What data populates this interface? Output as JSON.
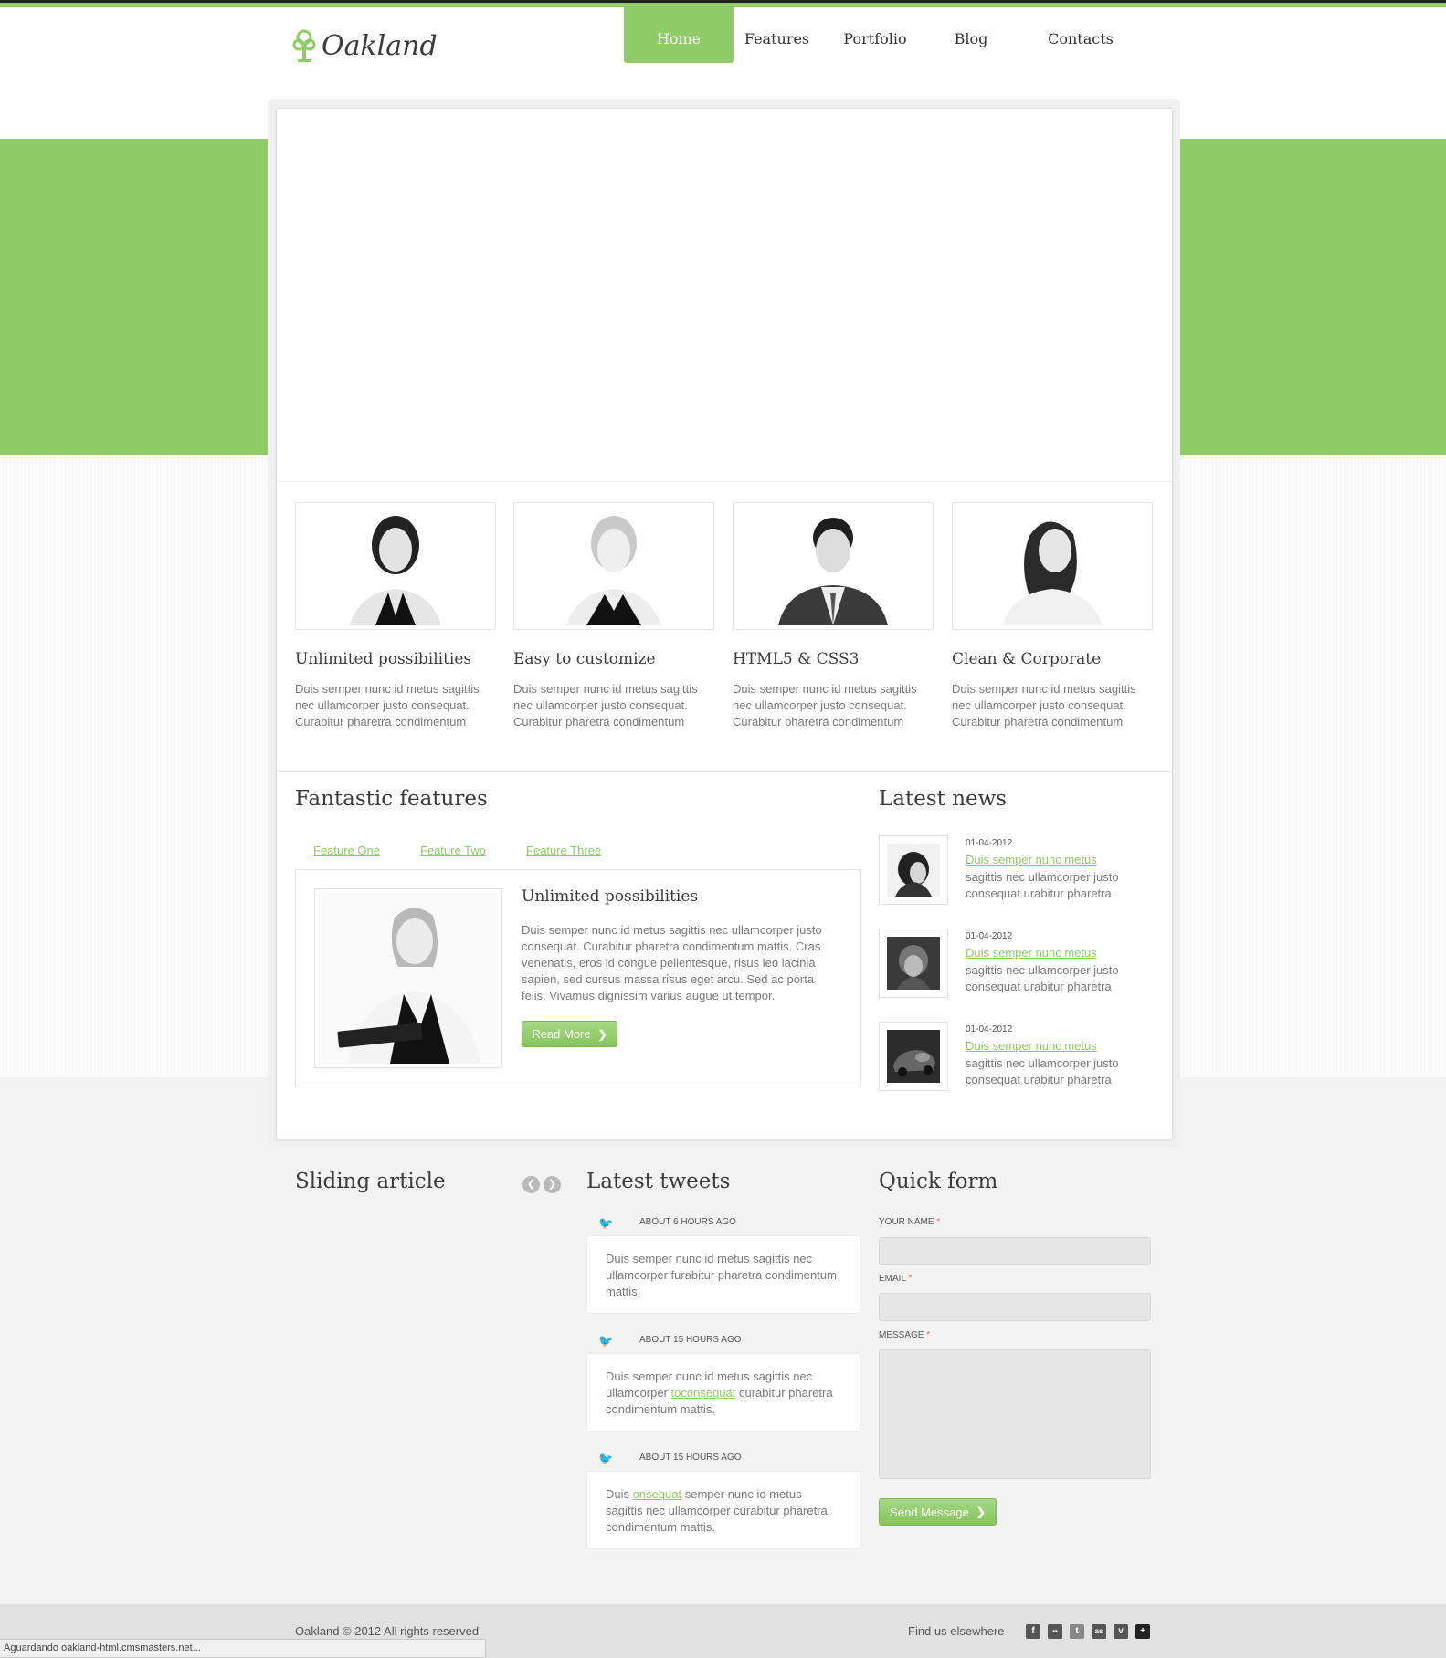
{
  "brand": {
    "name": "Oakland",
    "logo_icon": "tree-icon",
    "accent": "#8fcb67"
  },
  "nav": [
    {
      "label": "Home",
      "active": true
    },
    {
      "label": "Features",
      "active": false
    },
    {
      "label": "Portfolio",
      "active": false
    },
    {
      "label": "Blog",
      "active": false
    },
    {
      "label": "Contacts",
      "active": false
    }
  ],
  "features": [
    {
      "title": "Unlimited possibilities",
      "text": "Duis semper nunc id metus sagittis nec ullamcorper justo consequat. Curabitur pharetra condimentum"
    },
    {
      "title": "Easy to customize",
      "text": "Duis semper nunc id metus sagittis nec ullamcorper justo consequat. Curabitur pharetra condimentum"
    },
    {
      "title": "HTML5 & CSS3",
      "text": "Duis semper nunc id metus sagittis nec ullamcorper justo consequat. Curabitur pharetra condimentum"
    },
    {
      "title": "Clean & Corporate",
      "text": "Duis semper nunc id metus sagittis nec ullamcorper justo consequat. Curabitur pharetra condimentum"
    }
  ],
  "fantastic": {
    "title": "Fantastic features",
    "tabs": [
      "Feature One",
      "Feature Two",
      "Feature Three"
    ],
    "heading": "Unlimited possibilities",
    "text": "Duis semper nunc id metus sagittis nec ullamcorper justo consequat. Curabitur pharetra condimentum mattis. Cras venenatis, eros id congue pellentesque, risus leo lacinia sapien, sed cursus massa risus eget arcu. Sed ac porta felis. Vivamus dignissim varius augue ut tempor.",
    "button": "Read More"
  },
  "news": {
    "title": "Latest news",
    "items": [
      {
        "date": "01-04-2012",
        "link": "Duis semper nunc metus",
        "text": "sagittis nec ullamcorper justo consequat urabitur pharetra"
      },
      {
        "date": "01-04-2012",
        "link": "Duis semper nunc metus",
        "text": "sagittis nec ullamcorper justo consequat urabitur pharetra"
      },
      {
        "date": "01-04-2012",
        "link": "Duis semper nunc metus",
        "text": "sagittis nec ullamcorper justo consequat urabitur pharetra"
      }
    ]
  },
  "sliding": {
    "title": "Sliding article"
  },
  "tweets": {
    "title": "Latest tweets",
    "items": [
      {
        "time": "ABOUT 6 HOURS AGO",
        "before": "Duis semper nunc id metus sagittis nec ullamcorper furabitur pharetra condimentum mattis.",
        "link": "",
        "after": ""
      },
      {
        "time": "ABOUT 15 HOURS AGO",
        "before": "Duis semper nunc id metus sagittis nec ullamcorper ",
        "link": "toconsequat",
        "after": " curabitur pharetra condimentum mattis."
      },
      {
        "time": "ABOUT 15 HOURS AGO",
        "before": "Duis ",
        "link": "onsequat",
        "after": " semper nunc id metus sagittis nec ullamcorper curabitur pharetra condimentum mattis."
      }
    ]
  },
  "form": {
    "title": "Quick form",
    "name_label": "YOUR NAME",
    "email_label": "EMAIL",
    "message_label": "MESSAGE",
    "required_mark": "*",
    "button": "Send Message"
  },
  "footer": {
    "copyright": "Oakland © 2012 All rights reserved",
    "find_us": "Find us elsewhere",
    "social": [
      {
        "icon": "facebook-icon",
        "glyph": "f"
      },
      {
        "icon": "flickr-icon",
        "glyph": "••"
      },
      {
        "icon": "twitter-icon",
        "glyph": "t"
      },
      {
        "icon": "lastfm-icon",
        "glyph": "as"
      },
      {
        "icon": "vimeo-icon",
        "glyph": "v"
      },
      {
        "icon": "googleplus-icon",
        "glyph": "+"
      }
    ]
  },
  "status_bar": "Aguardando oakland-html.cmsmasters.net..."
}
